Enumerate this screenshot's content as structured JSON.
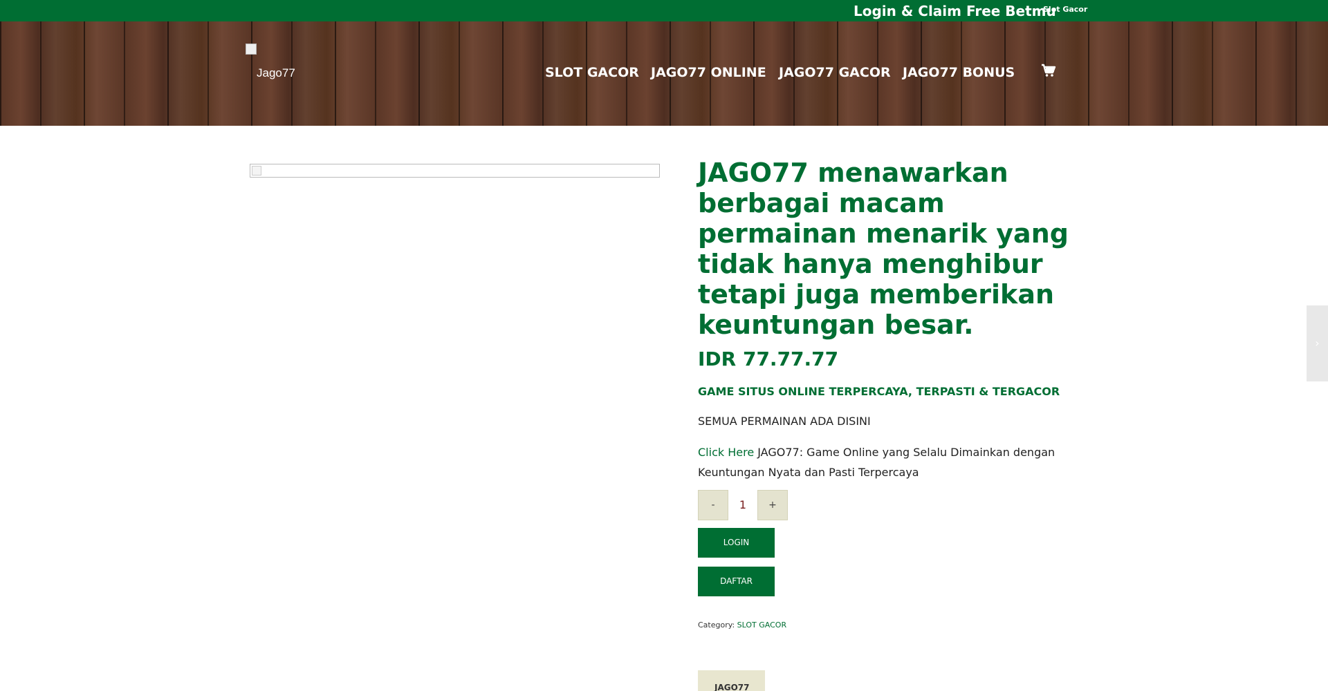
{
  "topbar": {
    "promo_label": "Login & Claim Free Betmu",
    "small_link": "Slot Gacor"
  },
  "header": {
    "logo_text": "Jago77",
    "nav": [
      "SLOT GACOR",
      "JAGO77 ONLINE",
      "JAGO77 GACOR",
      "JAGO77 BONUS"
    ],
    "cart_icon": "shopping-cart-icon"
  },
  "product": {
    "title": "JAGO77 menawarkan berbagai macam permainan menarik yang tidak hanya menghibur tetapi juga memberikan keuntungan besar.",
    "price": "IDR 77.77.77",
    "subheading": "GAME SITUS ONLINE TERPERCAYA, TERPASTI & TERGACOR",
    "paragraph1": "SEMUA PERMAINAN ADA DISINI",
    "link_text": "Click Here",
    "paragraph2": " JAGO77: Game Online yang Selalu Dimainkan dengan Keuntungan Nyata dan Pasti Terpercaya",
    "quantity": {
      "minus_label": "-",
      "value": "1",
      "plus_label": "+"
    },
    "login_label": "LOGIN",
    "daftar_label": "DAFTAR",
    "category_label": "Category:",
    "category_value": "SLOT GACOR",
    "bottom_tab": "JAGO77"
  },
  "side_arrow_icon": "chevron-right-icon",
  "colors": {
    "brand_green": "#006e33",
    "qty_button": "#e4e3cf"
  }
}
